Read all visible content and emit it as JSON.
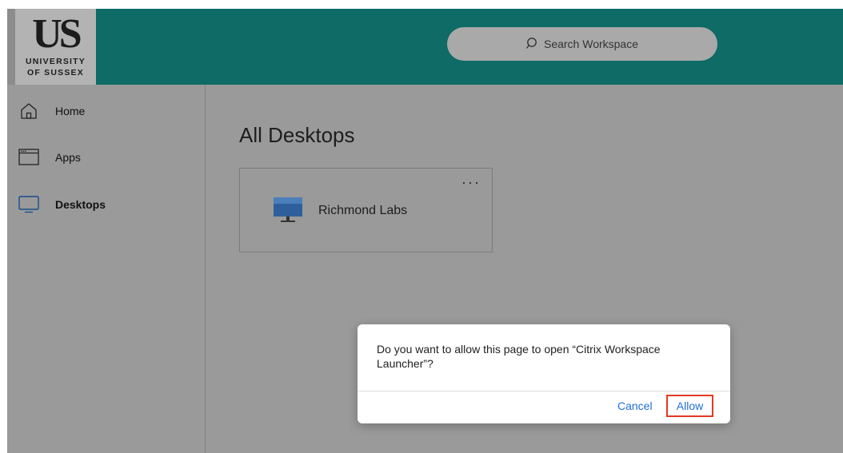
{
  "header": {
    "logo": {
      "mark": "US",
      "line1": "UNIVERSITY",
      "line2": "OF SUSSEX"
    },
    "search": {
      "placeholder": "Search Workspace",
      "icon": "search-icon"
    }
  },
  "sidebar": {
    "items": [
      {
        "label": "Home",
        "icon": "home-icon",
        "active": false
      },
      {
        "label": "Apps",
        "icon": "apps-window-icon",
        "active": false
      },
      {
        "label": "Desktops",
        "icon": "desktop-monitor-icon",
        "active": true
      }
    ]
  },
  "main": {
    "title": "All Desktops",
    "cards": [
      {
        "label": "Richmond Labs",
        "icon": "desktop-monitor-icon",
        "more": "···"
      }
    ]
  },
  "dialog": {
    "message": "Do you want to allow this page to open “Citrix Workspace Launcher”?",
    "cancel_label": "Cancel",
    "allow_label": "Allow"
  },
  "colors": {
    "header_teal": "#0e6b66",
    "overlay_gray": "#9a9a9a",
    "link_blue": "#1f6fd6",
    "highlight_red": "#e23a24"
  }
}
